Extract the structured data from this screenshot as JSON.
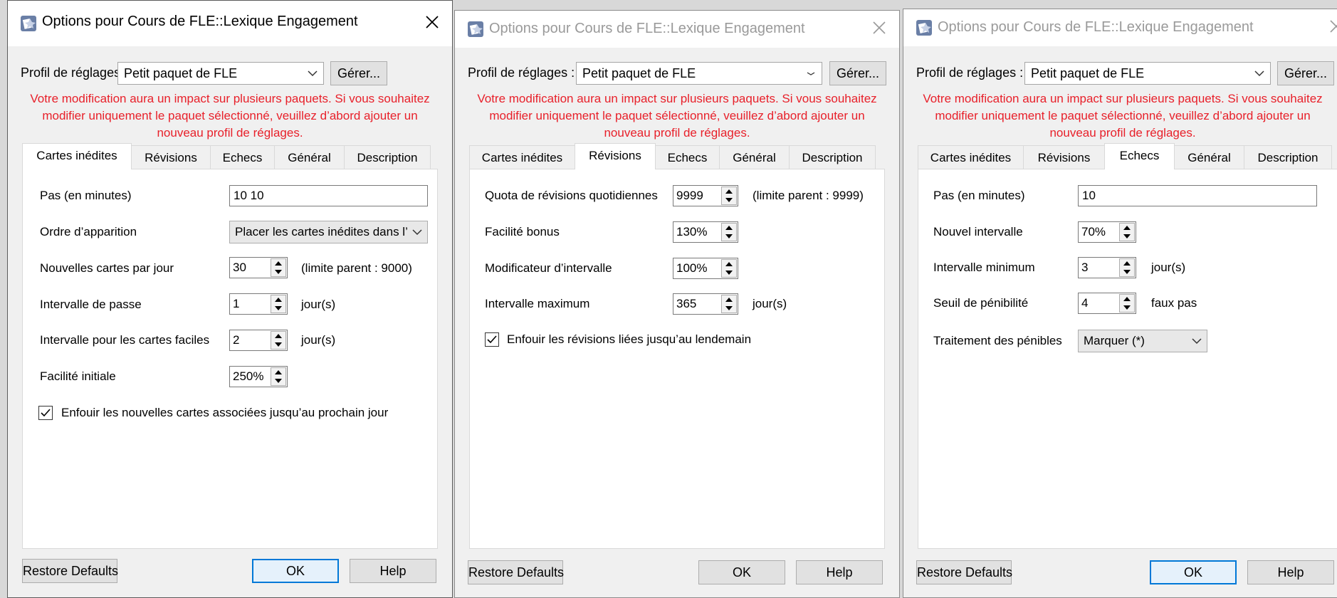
{
  "windows": [
    {
      "title": "Options pour Cours de FLE::Lexique Engagement",
      "profile_label": "Profil de réglages :",
      "profile_value": "Petit paquet de FLE",
      "manage_label": "Gérer...",
      "warning": "Votre modification aura un impact sur plusieurs paquets. Si vous souhaitez modifier uniquement le paquet sélectionné, veuillez d’abord ajouter un nouveau profil de réglages.",
      "tabs": [
        "Cartes inédites",
        "Révisions",
        "Echecs",
        "Général",
        "Description"
      ],
      "active_tab": "Cartes inédites",
      "fields": {
        "steps_label": "Pas (en minutes)",
        "steps_value": "10 10",
        "order_label": "Ordre d’apparition",
        "order_value": "Placer les cartes inédites dans l’",
        "per_day_label": "Nouvelles cartes par jour",
        "per_day_value": "30",
        "per_day_suffix": "(limite parent : 9000)",
        "graduating_label": "Intervalle de passe",
        "graduating_value": "1",
        "graduating_suffix": "jour(s)",
        "easy_label": "Intervalle pour les cartes faciles",
        "easy_value": "2",
        "easy_suffix": "jour(s)",
        "ease_label": "Facilité initiale",
        "ease_value": "250%",
        "bury_label": "Enfouir les nouvelles cartes associées jusqu’au prochain jour",
        "bury_checked": true
      },
      "restore_label": "Restore Defaults",
      "ok_label": "OK",
      "help_label": "Help"
    },
    {
      "title": "Options pour Cours de FLE::Lexique Engagement",
      "profile_label": "Profil de réglages :",
      "profile_value": "Petit paquet de FLE",
      "manage_label": "Gérer...",
      "warning": "Votre modification aura un impact sur plusieurs paquets. Si vous souhaitez modifier uniquement le paquet sélectionné, veuillez d’abord ajouter un nouveau profil de réglages.",
      "tabs": [
        "Cartes inédites",
        "Révisions",
        "Echecs",
        "Général",
        "Description"
      ],
      "active_tab": "Révisions",
      "fields": {
        "quota_label": "Quota de révisions quotidiennes",
        "quota_value": "9999",
        "quota_suffix": "(limite parent : 9999)",
        "bonus_label": "Facilité bonus",
        "bonus_value": "130%",
        "modifier_label": "Modificateur d’intervalle",
        "modifier_value": "100%",
        "max_label": "Intervalle maximum",
        "max_value": "365",
        "max_suffix": "jour(s)",
        "bury_label": "Enfouir les révisions liées jusqu’au lendemain",
        "bury_checked": true
      },
      "restore_label": "Restore Defaults",
      "ok_label": "OK",
      "help_label": "Help"
    },
    {
      "title": "Options pour Cours de FLE::Lexique Engagement",
      "profile_label": "Profil de réglages :",
      "profile_value": "Petit paquet de FLE",
      "manage_label": "Gérer...",
      "warning": "Votre modification aura un impact sur plusieurs paquets. Si vous souhaitez modifier uniquement le paquet sélectionné, veuillez d’abord ajouter un nouveau profil de réglages.",
      "tabs": [
        "Cartes inédites",
        "Révisions",
        "Echecs",
        "Général",
        "Description"
      ],
      "active_tab": "Echecs",
      "fields": {
        "steps_label": "Pas (en minutes)",
        "steps_value": "10",
        "new_interval_label": "Nouvel intervalle",
        "new_interval_value": "70%",
        "min_interval_label": "Intervalle minimum",
        "min_interval_value": "3",
        "min_interval_suffix": "jour(s)",
        "leech_label": "Seuil de pénibilité",
        "leech_value": "4",
        "leech_suffix": "faux pas",
        "leech_action_label": "Traitement des pénibles",
        "leech_action_value": "Marquer (*)"
      },
      "restore_label": "Restore Defaults",
      "ok_label": "OK",
      "help_label": "Help"
    }
  ],
  "colors": {
    "warning": "#e8202a",
    "accent": "#0078d7",
    "dialog_bg": "#f0f0f0"
  }
}
